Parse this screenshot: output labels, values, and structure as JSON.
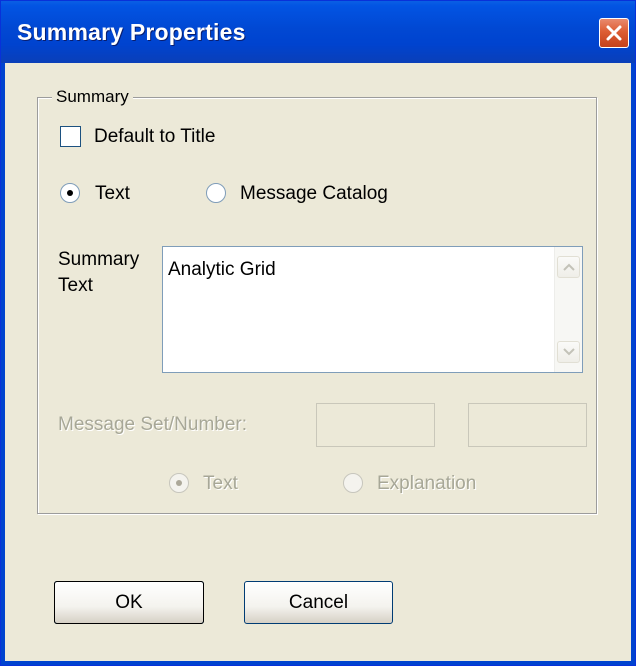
{
  "window": {
    "title": "Summary Properties",
    "close_icon": "close-icon"
  },
  "summary_group": {
    "legend": "Summary",
    "default_to_title_label": "Default to Title",
    "default_to_title_checked": false,
    "source_options": [
      {
        "label": "Text",
        "selected": true
      },
      {
        "label": "Message Catalog",
        "selected": false
      }
    ],
    "summary_text_label_line1": "Summary",
    "summary_text_label_line2": "Text",
    "summary_text_value": "Analytic Grid",
    "message_set_label": "Message Set/Number:",
    "message_set_value": "",
    "message_number_value": "",
    "message_options": [
      {
        "label": "Text",
        "selected": true,
        "enabled": false
      },
      {
        "label": "Explanation",
        "selected": false,
        "enabled": false
      }
    ]
  },
  "buttons": {
    "ok_label": "OK",
    "cancel_label": "Cancel"
  },
  "colors": {
    "titlebar": "#0043cf",
    "dialog_background": "#ece9d8",
    "close_button": "#dd5d33",
    "disabled_text": "#a7a797"
  }
}
